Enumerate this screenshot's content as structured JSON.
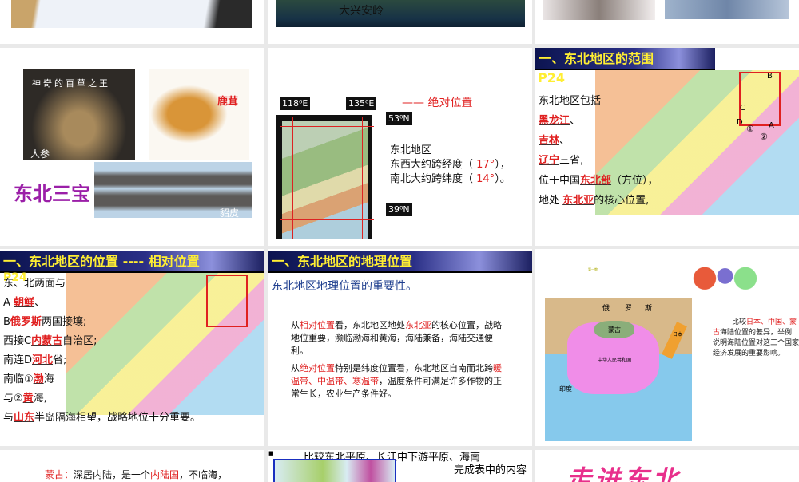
{
  "slides": {
    "s2": {
      "caption": "大兴安岭"
    },
    "s4": {
      "title": "东北三宝",
      "ginseng_caption": "神奇的百草之王",
      "ginseng": "人参",
      "antler": "鹿茸",
      "fur": "貂皮"
    },
    "s5": {
      "heading": "—— 绝对位置",
      "lon1": "118⁰E",
      "lon2": "135⁰E",
      "lat1": "53⁰N",
      "lat2": "39⁰N",
      "line1": "东北地区",
      "line2a": "东西大约跨经度（ ",
      "line2v": "17°",
      "line2b": "），",
      "line3a": "南北大约跨纬度（ ",
      "line3v": "14°",
      "line3b": "）。"
    },
    "s6": {
      "header": "一、东北地区的范围",
      "page": "P24",
      "intro": "东北地区包括",
      "p1": "黑龙江",
      "p2": "吉林",
      "p3": "辽宁",
      "sep": "、",
      "three": "三省,",
      "loc_a": "位于中国",
      "loc_v": "东北部",
      "loc_b": "（方位），",
      "core_a": "地处",
      "core_v": "东北亚",
      "core_b": "的核心位置,",
      "markers": [
        "A",
        "B",
        "C",
        "D",
        "①",
        "②"
      ]
    },
    "s7": {
      "header": "一、东北地区的位置 ---- 相对位置",
      "page": "P24",
      "l1": "东、北两面与",
      "l2a": "A",
      "l2v": "朝鲜",
      "l2b": "、",
      "l3a": "B",
      "l3v": "俄罗斯",
      "l3b": "两国接壤;",
      "l4a": "西接C",
      "l4v": "内蒙古",
      "l4b": "自治区;",
      "l5a": "南连D",
      "l5v": "河北",
      "l5b": "省;",
      "l6a": "南临①",
      "l6v": "渤",
      "l6b": "海",
      "l7a": "与②",
      "l7v": "黄",
      "l7b": "海,",
      "l8a": "与",
      "l8v": "山东",
      "l8b": "半岛隔海相望，战略地位十分重要。"
    },
    "s8": {
      "header": "一、东北地区的地理位置",
      "subtitle": "东北地区地理位置的重要性。",
      "p1": [
        "从",
        "相对位置",
        "看，东北地区地处",
        "东北亚",
        "的核心位置，战略地位重要，濒临渤海和黄海，海陆兼备，海陆交通便利。"
      ],
      "p2": [
        "从",
        "绝对位置",
        "特别是纬度位置看，东北地区自南而北跨",
        "暖温带、中温带、寒温带",
        "，温度条件可满足许多作物的正常生长，农业生产条件好。"
      ]
    },
    "s9": {
      "small": "第一教",
      "map_labels": [
        "俄",
        "罗",
        "斯",
        "蒙古",
        "中华人民共和国",
        "日本",
        "印度"
      ],
      "text": [
        "比较",
        "日本、中国、蒙古",
        "海陆位置的差异，举例说明海陆位置对这三个国家经济发展的重要影响。"
      ]
    },
    "s10": {
      "text": [
        "蒙古：",
        "深居内陆，是一个",
        "内陆国",
        "，不临海，"
      ]
    },
    "s11": {
      "text": "比较东北平原、长江中下游平原、海南",
      "text2": "完成表中的内容"
    },
    "s12": {
      "title": "走进东北"
    }
  }
}
